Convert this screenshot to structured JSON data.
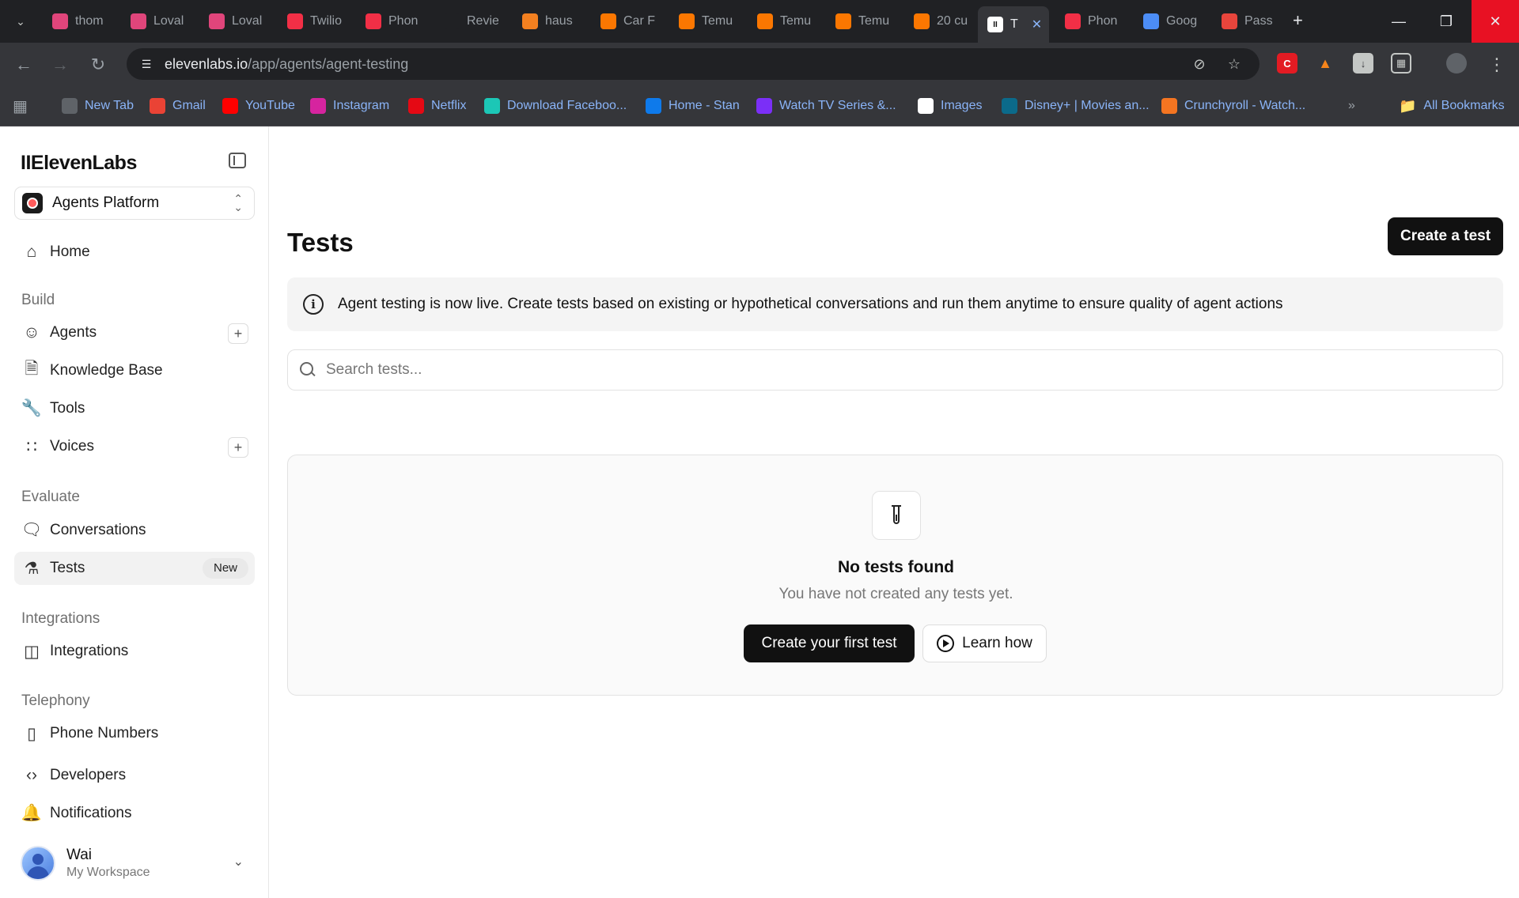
{
  "browser": {
    "tabs": [
      {
        "label": "thom",
        "icon": "lovable-icon",
        "color": "#e0457b"
      },
      {
        "label": "Loval",
        "icon": "lovable-icon",
        "color": "#e0457b"
      },
      {
        "label": "Loval",
        "icon": "lovable-icon",
        "color": "#e0457b"
      },
      {
        "label": "Twilio",
        "icon": "twilio-icon",
        "color": "#f22f46"
      },
      {
        "label": "Phon",
        "icon": "twilio-icon",
        "color": "#f22f46"
      },
      {
        "label": "Revie",
        "icon": "link-icon",
        "color": "#202124"
      },
      {
        "label": "haus",
        "icon": "cloudflare-icon",
        "color": "#f38020"
      },
      {
        "label": "Car F",
        "icon": "temu-icon",
        "color": "#fb7701"
      },
      {
        "label": "Temu",
        "icon": "temu-icon",
        "color": "#fb7701"
      },
      {
        "label": "Temu",
        "icon": "temu-icon",
        "color": "#fb7701"
      },
      {
        "label": "Temu",
        "icon": "temu-icon",
        "color": "#fb7701"
      },
      {
        "label": "20 cu",
        "icon": "temu-icon",
        "color": "#fb7701"
      },
      {
        "label": "T",
        "icon": "elevenlabs-icon",
        "color": "#ffffff",
        "active": true
      },
      {
        "label": "Phon",
        "icon": "twilio-icon",
        "color": "#f22f46"
      },
      {
        "label": "Goog",
        "icon": "gemini-icon",
        "color": "#4c8df6"
      },
      {
        "label": "Pass",
        "icon": "passkey-icon",
        "color": "#e8453c"
      }
    ],
    "url_domain": "elevenlabs.io",
    "url_path": "/app/agents/agent-testing",
    "bookmarks": [
      {
        "label": "New Tab",
        "icon": "globe-icon",
        "color": "#5f6368"
      },
      {
        "label": "Gmail",
        "icon": "gmail-icon",
        "color": "#ea4335"
      },
      {
        "label": "YouTube",
        "icon": "youtube-icon",
        "color": "#ff0000"
      },
      {
        "label": "Instagram",
        "icon": "instagram-icon",
        "color": "#d6249f"
      },
      {
        "label": "Netflix",
        "icon": "netflix-icon",
        "color": "#e50914"
      },
      {
        "label": "Download Faceboo...",
        "icon": "download-icon",
        "color": "#1cc7b6"
      },
      {
        "label": "Home - Stan",
        "icon": "stan-icon",
        "color": "#0e7aeb"
      },
      {
        "label": "Watch TV Series &...",
        "icon": "b-icon",
        "color": "#7b2ff7"
      },
      {
        "label": "Images",
        "icon": "google-icon",
        "color": "#ffffff"
      },
      {
        "label": "Disney+ | Movies an...",
        "icon": "disney-icon",
        "color": "#0b6a8a"
      },
      {
        "label": "Crunchyroll - Watch...",
        "icon": "crunchyroll-icon",
        "color": "#f47521"
      }
    ],
    "all_bookmarks": "All Bookmarks"
  },
  "sidebar": {
    "logo": "IIElevenLabs",
    "platform": "Agents Platform",
    "home": "Home",
    "sections": {
      "build": "Build",
      "evaluate": "Evaluate",
      "integrations": "Integrations",
      "telephony": "Telephony"
    },
    "items": {
      "agents": "Agents",
      "knowledge_base": "Knowledge Base",
      "tools": "Tools",
      "voices": "Voices",
      "conversations": "Conversations",
      "tests": "Tests",
      "tests_badge": "New",
      "integrations": "Integrations",
      "phone_numbers": "Phone Numbers",
      "developers": "Developers",
      "notifications": "Notifications"
    },
    "user": {
      "name": "Wai",
      "workspace": "My Workspace"
    }
  },
  "main": {
    "title": "Tests",
    "create_button": "Create a test",
    "banner": "Agent testing is now live. Create tests based on existing or hypothetical conversations and run them anytime to ensure quality of agent actions",
    "search_placeholder": "Search tests...",
    "empty": {
      "title": "No tests found",
      "subtitle": "You have not created any tests yet.",
      "primary_button": "Create your first test",
      "secondary_button": "Learn how"
    }
  }
}
